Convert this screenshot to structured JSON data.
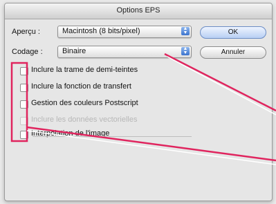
{
  "dialog": {
    "title": "Options EPS",
    "preview": {
      "label": "Aperçu :",
      "value": "Macintosh (8 bits/pixel)"
    },
    "encoding": {
      "label": "Codage :",
      "value": "Binaire"
    },
    "buttons": {
      "ok": "OK",
      "cancel": "Annuler"
    },
    "options": [
      {
        "label": "Inclure la trame de demi-teintes",
        "checked": false,
        "enabled": true
      },
      {
        "label": "Inclure la fonction de transfert",
        "checked": false,
        "enabled": true
      },
      {
        "label": "Gestion des couleurs Postscript",
        "checked": false,
        "enabled": true
      },
      {
        "label": "Inclure les données vectorielles",
        "checked": false,
        "enabled": false
      },
      {
        "label": "Interpolation de l'image",
        "checked": false,
        "enabled": true
      }
    ]
  },
  "annotation": {
    "color": "#e0245e"
  }
}
